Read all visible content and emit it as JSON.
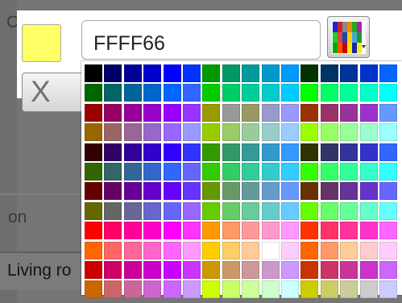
{
  "background": {
    "label_top": "C",
    "label_on": "on",
    "label_room": "Living ro"
  },
  "color_picker": {
    "current_color": "#FFFF66",
    "hex_value": "FFFF66",
    "clear_label": "X"
  },
  "palette": {
    "rows": [
      [
        "#000000",
        "#000066",
        "#000099",
        "#0000cc",
        "#0000ff",
        "#0033ff",
        "#009900",
        "#009966",
        "#009999",
        "#0099cc",
        "#0099ff",
        "#003300",
        "#003366",
        "#003399",
        "#0033cc",
        "#0066ff"
      ],
      [
        "#006600",
        "#006666",
        "#006699",
        "#0066cc",
        "#0066ff",
        "#3366ff",
        "#00cc00",
        "#00cc66",
        "#00cc99",
        "#00cccc",
        "#00ccff",
        "#00ff00",
        "#00ff66",
        "#00ff99",
        "#00ffcc",
        "#00ffff"
      ],
      [
        "#990000",
        "#990066",
        "#990099",
        "#9900cc",
        "#9900ff",
        "#9933ff",
        "#999900",
        "#999999",
        "#999966",
        "#9999cc",
        "#9999ff",
        "#993300",
        "#993366",
        "#993399",
        "#9933cc",
        "#6699ff"
      ],
      [
        "#996600",
        "#996666",
        "#996699",
        "#9966cc",
        "#9966ff",
        "#9999ff",
        "#99cc00",
        "#99cc66",
        "#99cc99",
        "#99cccc",
        "#99ccff",
        "#99ff00",
        "#99ff66",
        "#99ff99",
        "#99ffcc",
        "#99ffff"
      ],
      [
        "#330000",
        "#330066",
        "#330099",
        "#3300cc",
        "#3300ff",
        "#3333ff",
        "#339900",
        "#339966",
        "#339999",
        "#3399cc",
        "#3399ff",
        "#333300",
        "#333366",
        "#333399",
        "#3333cc",
        "#3366ff"
      ],
      [
        "#336600",
        "#336666",
        "#336699",
        "#3366cc",
        "#3366ff",
        "#6666ff",
        "#33cc00",
        "#33cc66",
        "#33cc99",
        "#33cccc",
        "#33ccff",
        "#33ff00",
        "#33ff66",
        "#33ff99",
        "#33ffcc",
        "#33ffff"
      ],
      [
        "#660000",
        "#660066",
        "#660099",
        "#6600cc",
        "#6600ff",
        "#6633ff",
        "#669900",
        "#669966",
        "#669999",
        "#6699cc",
        "#6699ff",
        "#663300",
        "#663366",
        "#663399",
        "#6633cc",
        "#6666ff"
      ],
      [
        "#666600",
        "#666666",
        "#666699",
        "#6666cc",
        "#6666ff",
        "#9966ff",
        "#66cc00",
        "#66cc66",
        "#66cc99",
        "#66cccc",
        "#66ccff",
        "#66ff00",
        "#66ff66",
        "#66ff99",
        "#66ffcc",
        "#66ffff"
      ],
      [
        "#ff0000",
        "#ff0066",
        "#ff0099",
        "#ff00cc",
        "#ff00ff",
        "#ff33ff",
        "#ff9900",
        "#ff9966",
        "#ff9999",
        "#ff99cc",
        "#ff99ff",
        "#ff3300",
        "#ff3366",
        "#ff3399",
        "#ff33cc",
        "#ff66ff"
      ],
      [
        "#ff6600",
        "#ff6666",
        "#ff6699",
        "#ff66cc",
        "#ff66ff",
        "#ff99ff",
        "#ffcc00",
        "#ffcc66",
        "#ffcc99",
        "#ffffff",
        "#ffccff",
        "#ff6600",
        "#ff9966",
        "#ffcc99",
        "#ffcccc",
        "#ffccff"
      ],
      [
        "#cc0000",
        "#cc0066",
        "#cc0099",
        "#cc00cc",
        "#cc00ff",
        "#cc33ff",
        "#cc9900",
        "#cc9966",
        "#cc9999",
        "#cc99cc",
        "#cc99ff",
        "#cc3300",
        "#cc3366",
        "#cc3399",
        "#cc33cc",
        "#cc66ff"
      ],
      [
        "#cc6600",
        "#cc6666",
        "#cc6699",
        "#cc66cc",
        "#cc66ff",
        "#cc99ff",
        "#ccff00",
        "#ccff66",
        "#ccff99",
        "#ccffcc",
        "#ccffff",
        "#cccc00",
        "#cccc66",
        "#cccc99",
        "#cccccc",
        "#ccccff"
      ]
    ]
  }
}
